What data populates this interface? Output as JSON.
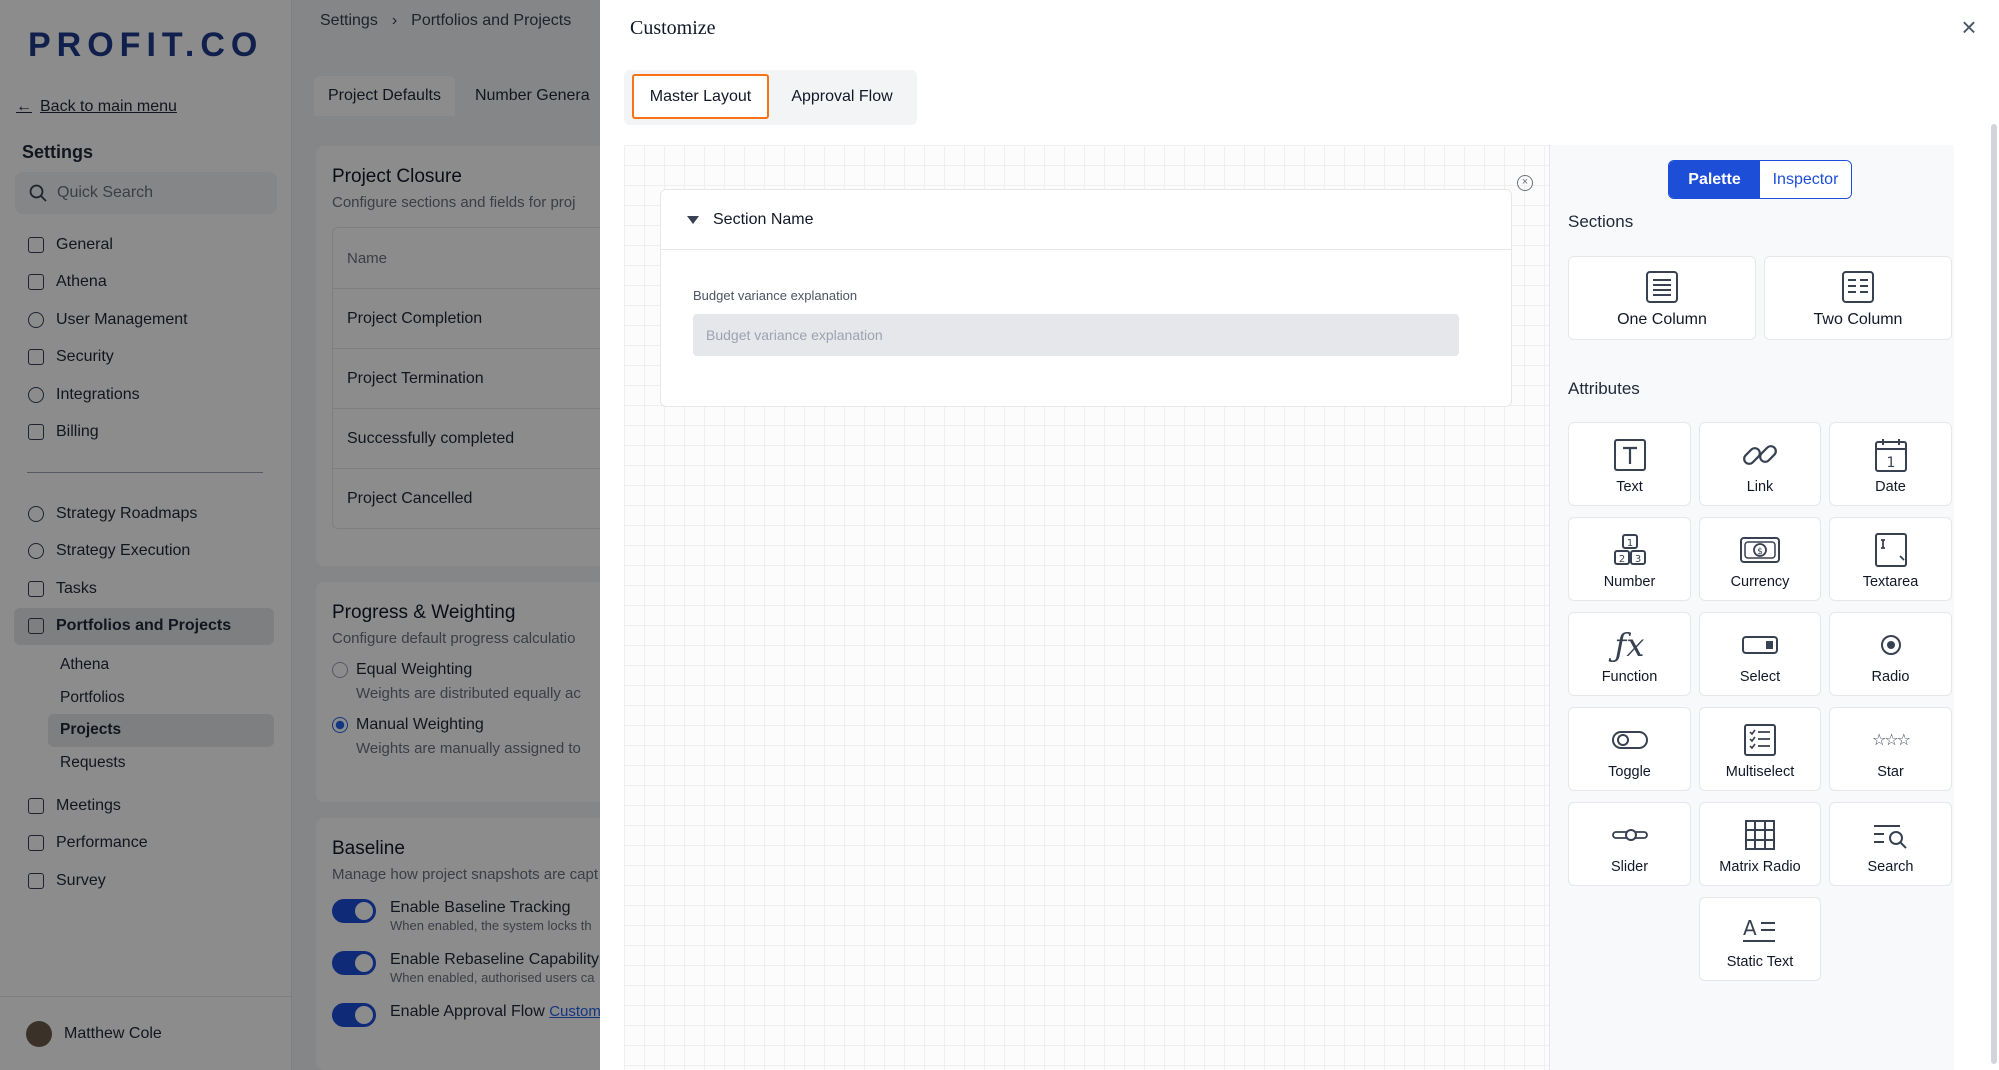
{
  "sidebar": {
    "logo": "PROFIT.CO",
    "back_link": "Back to main menu",
    "title": "Settings",
    "search_placeholder": "Quick Search",
    "items_top": [
      {
        "label": "General"
      },
      {
        "label": "Athena"
      },
      {
        "label": "User Management"
      },
      {
        "label": "Security"
      },
      {
        "label": "Integrations"
      },
      {
        "label": "Billing"
      }
    ],
    "items_mid": [
      {
        "label": "Strategy Roadmaps"
      },
      {
        "label": "Strategy Execution"
      },
      {
        "label": "Tasks"
      },
      {
        "label": "Portfolios and Projects"
      }
    ],
    "sub_items": [
      {
        "label": "Athena"
      },
      {
        "label": "Portfolios"
      },
      {
        "label": "Projects"
      },
      {
        "label": "Requests"
      }
    ],
    "items_bottom": [
      {
        "label": "Meetings"
      },
      {
        "label": "Performance"
      },
      {
        "label": "Survey"
      }
    ],
    "user_name": "Matthew Cole"
  },
  "background": {
    "breadcrumb": [
      "Settings",
      "›",
      "Portfolios and Projects"
    ],
    "tabs": [
      "Project Defaults",
      "Number Genera"
    ],
    "closure": {
      "title": "Project Closure",
      "desc": "Configure sections and fields for proj",
      "col_header": "Name",
      "rows": [
        "Project Completion",
        "Project Termination",
        "Successfully completed",
        "Project Cancelled"
      ]
    },
    "progress": {
      "title": "Progress & Weighting",
      "desc": "Configure default progress calculatio",
      "opt1": "Equal Weighting",
      "opt1_desc": "Weights are distributed equally ac",
      "opt2": "Manual Weighting",
      "opt2_desc": "Weights are manually assigned to"
    },
    "baseline": {
      "title": "Baseline",
      "desc": "Manage how project snapshots are capt",
      "t1": "Enable Baseline Tracking",
      "t1_desc": "When enabled, the system locks th",
      "t2": "Enable Rebaseline Capability",
      "t2_desc": "When enabled, authorised users ca",
      "t3": "Enable Approval Flow",
      "t3_link": "Custom"
    }
  },
  "modal": {
    "title": "Customize",
    "tabs": [
      "Master Layout",
      "Approval Flow"
    ],
    "section": {
      "name": "Section Name",
      "field_label": "Budget variance explanation",
      "field_placeholder": "Budget variance explanation"
    },
    "panel": {
      "toggle": [
        "Palette",
        "Inspector"
      ],
      "sections_heading": "Sections",
      "sections": [
        "One Column",
        "Two Column"
      ],
      "attributes_heading": "Attributes",
      "attributes": [
        "Text",
        "Link",
        "Date",
        "Number",
        "Currency",
        "Textarea",
        "Function",
        "Select",
        "Radio",
        "Toggle",
        "Multiselect",
        "Star",
        "Slider",
        "Matrix Radio",
        "Search",
        "Static Text"
      ]
    }
  },
  "colors": {
    "accent": "#1d4ed8",
    "active_tab_border": "#f97316"
  }
}
